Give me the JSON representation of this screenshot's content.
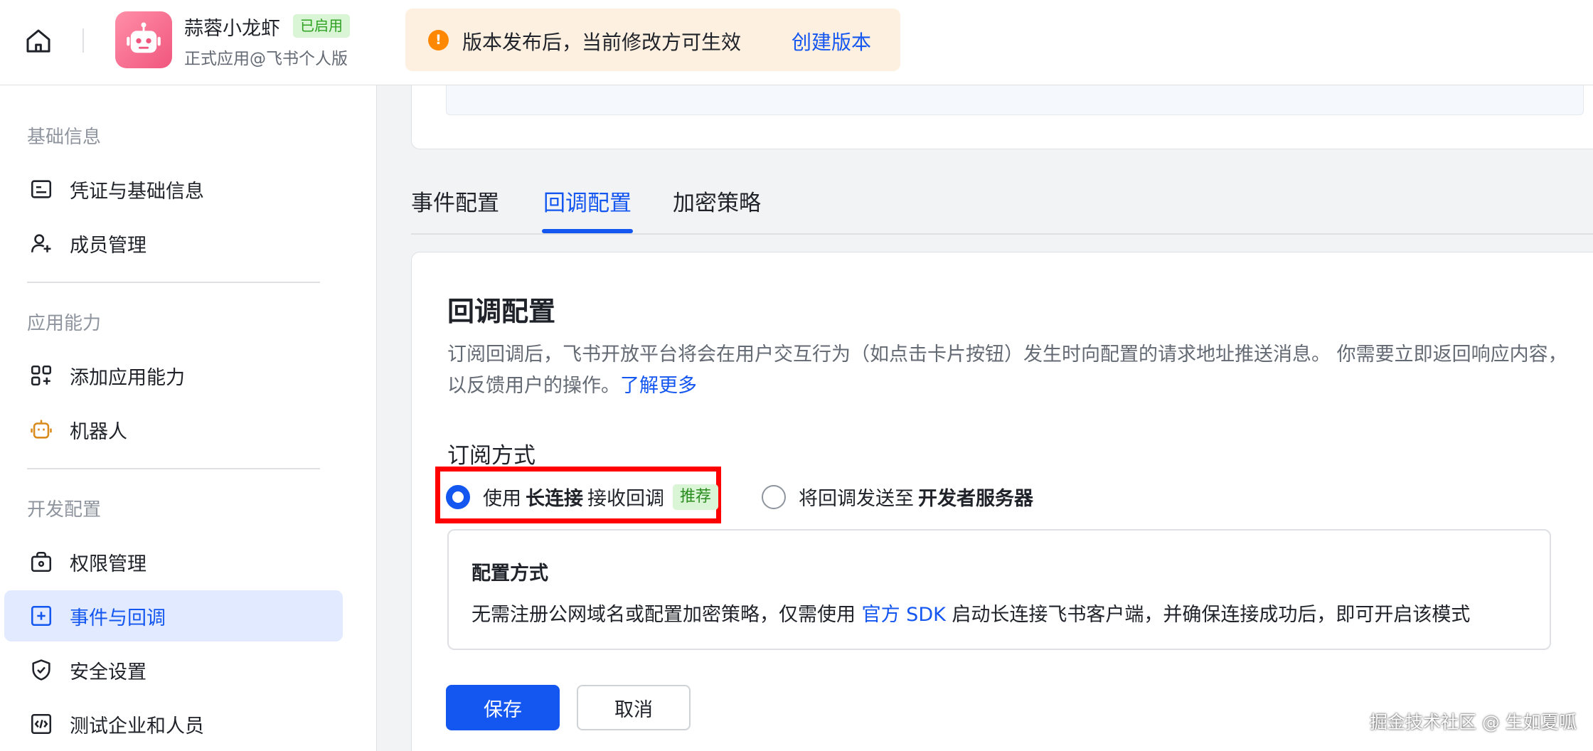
{
  "header": {
    "app_name": "蒜蓉小龙虾",
    "app_status": "已启用",
    "app_subtitle": "正式应用@飞书个人版",
    "notice": {
      "text": "版本发布后，当前修改方可生效",
      "link": "创建版本",
      "icon": "!"
    }
  },
  "sidebar": {
    "sections": [
      {
        "title": "基础信息",
        "items": [
          {
            "label": "凭证与基础信息",
            "icon": "credential-icon"
          },
          {
            "label": "成员管理",
            "icon": "add-member-icon"
          }
        ]
      },
      {
        "title": "应用能力",
        "items": [
          {
            "label": "添加应用能力",
            "icon": "add-capability-icon"
          },
          {
            "label": "机器人",
            "icon": "robot-icon"
          }
        ]
      },
      {
        "title": "开发配置",
        "items": [
          {
            "label": "权限管理",
            "icon": "permission-icon"
          },
          {
            "label": "事件与回调",
            "icon": "event-callback-icon",
            "active": true
          },
          {
            "label": "安全设置",
            "icon": "shield-icon"
          },
          {
            "label": "测试企业和人员",
            "icon": "code-icon"
          }
        ]
      }
    ]
  },
  "tabs": [
    {
      "label": "事件配置"
    },
    {
      "label": "回调配置",
      "active": true
    },
    {
      "label": "加密策略"
    }
  ],
  "callback": {
    "title": "回调配置",
    "desc": "订阅回调后，飞书开放平台将会在用户交互行为（如点击卡片按钮）发生时向配置的请求地址推送消息。 你需要立即返回响应内容，以反馈用户的操作。",
    "learn_more": "了解更多",
    "subscribe_title": "订阅方式",
    "options": [
      {
        "prefix": "使用",
        "bold": "长连接",
        "suffix": "接收回调",
        "tag": "推荐",
        "selected": true
      },
      {
        "prefix": "将回调发送至",
        "bold": "开发者服务器",
        "suffix": "",
        "selected": false
      }
    ],
    "config": {
      "title": "配置方式",
      "desc_before": "无需注册公网域名或配置加密策略，仅需使用",
      "desc_link": "官方 SDK",
      "desc_after": "启动长连接飞书客户端，并确保连接成功后，即可开启该模式"
    },
    "save_label": "保存",
    "cancel_label": "取消"
  },
  "watermark": "掘金技术社区 @ 生如夏呱",
  "colors": {
    "accent": "#1456f0",
    "warning": "#ff8800",
    "success_bg": "#d9f5d6",
    "highlight": "#ff0000"
  }
}
